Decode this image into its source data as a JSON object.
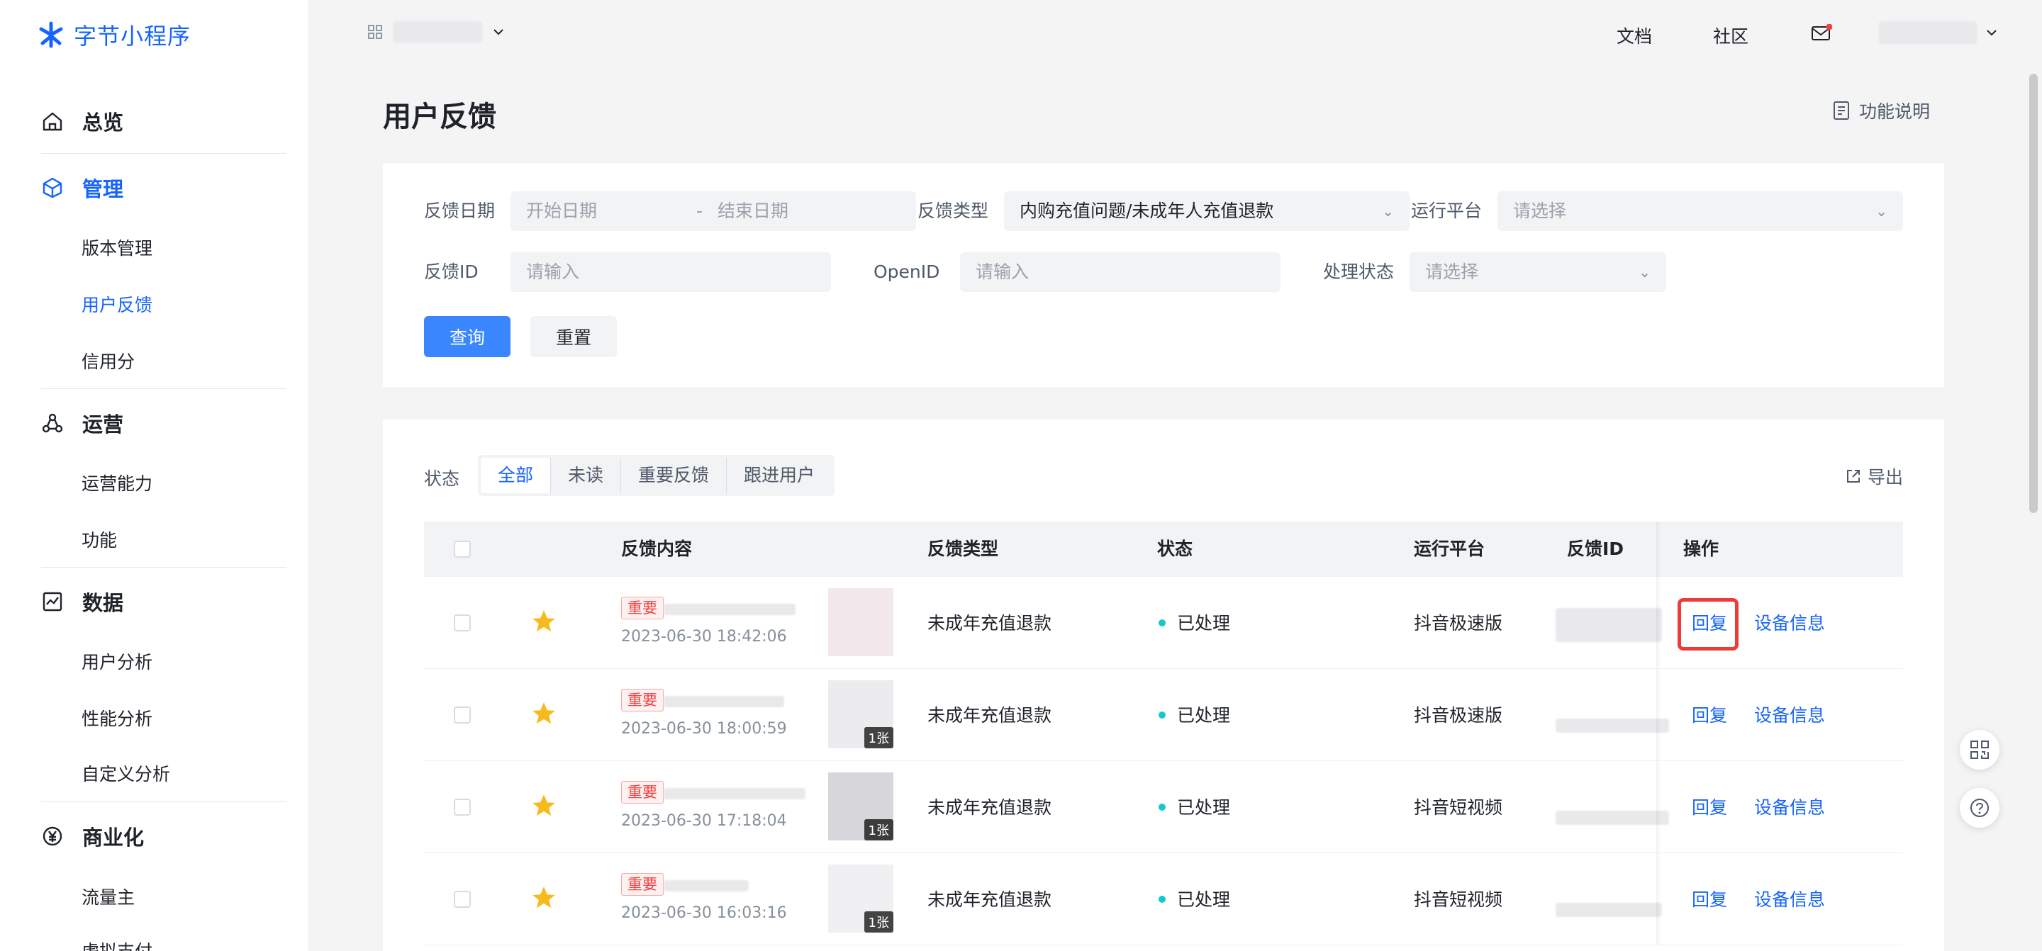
{
  "brand": {
    "name": "字节小程序",
    "color": "#1664ff"
  },
  "sidebar": {
    "sections": [
      {
        "icon": "home-icon",
        "label": "总览",
        "items": []
      },
      {
        "icon": "cube-icon",
        "label": "管理",
        "items": [
          "版本管理",
          "用户反馈",
          "信用分"
        ]
      },
      {
        "icon": "share-icon",
        "label": "运营",
        "items": [
          "运营能力",
          "功能"
        ]
      },
      {
        "icon": "chart-icon",
        "label": "数据",
        "items": [
          "用户分析",
          "性能分析",
          "自定义分析"
        ]
      },
      {
        "icon": "yen-icon",
        "label": "商业化",
        "items": [
          "流量主",
          "虚拟支付"
        ]
      }
    ],
    "active_section": "管理",
    "active_item": "用户反馈"
  },
  "topbar": {
    "docs": "文档",
    "community": "社区"
  },
  "page": {
    "title": "用户反馈",
    "help": "功能说明"
  },
  "filters": {
    "date_label": "反馈日期",
    "start_placeholder": "开始日期",
    "date_sep": "-",
    "end_placeholder": "结束日期",
    "type_label": "反馈类型",
    "type_value": "内购充值问题/未成年人充值退款",
    "platform_label": "运行平台",
    "platform_placeholder": "请选择",
    "id_label": "反馈ID",
    "id_placeholder": "请输入",
    "openid_label": "OpenID",
    "openid_placeholder": "请输入",
    "status_label": "处理状态",
    "status_placeholder": "请选择",
    "query_btn": "查询",
    "reset_btn": "重置"
  },
  "status_tabs": {
    "label": "状态",
    "tabs": [
      "全部",
      "未读",
      "重要反馈",
      "跟进用户"
    ],
    "active": "全部",
    "export": "导出"
  },
  "table": {
    "columns": [
      "反馈内容",
      "反馈类型",
      "状态",
      "运行平台",
      "反馈ID",
      "操作"
    ],
    "rows": [
      {
        "tag": "重要",
        "time": "2023-06-30 18:42:06",
        "type": "未成年充值退款",
        "status": "已处理",
        "platform": "抖音极速版",
        "badge": "",
        "reply": "回复",
        "device": "设备信息"
      },
      {
        "tag": "重要",
        "time": "2023-06-30 18:00:59",
        "type": "未成年充值退款",
        "status": "已处理",
        "platform": "抖音极速版",
        "badge": "1张",
        "reply": "回复",
        "device": "设备信息"
      },
      {
        "tag": "重要",
        "time": "2023-06-30 17:18:04",
        "type": "未成年充值退款",
        "status": "已处理",
        "platform": "抖音短视频",
        "badge": "1张",
        "reply": "回复",
        "device": "设备信息"
      },
      {
        "tag": "重要",
        "time": "2023-06-30 16:03:16",
        "type": "未成年充值退款",
        "status": "已处理",
        "platform": "抖音短视频",
        "badge": "1张",
        "reply": "回复",
        "device": "设备信息"
      }
    ]
  },
  "colors": {
    "primary": "#3a86ff",
    "link": "#1664ff",
    "important": "#f53f3f",
    "status_dot": "#14c9c9",
    "star": "#f7ba1e",
    "highlight": "#f03a3a"
  }
}
